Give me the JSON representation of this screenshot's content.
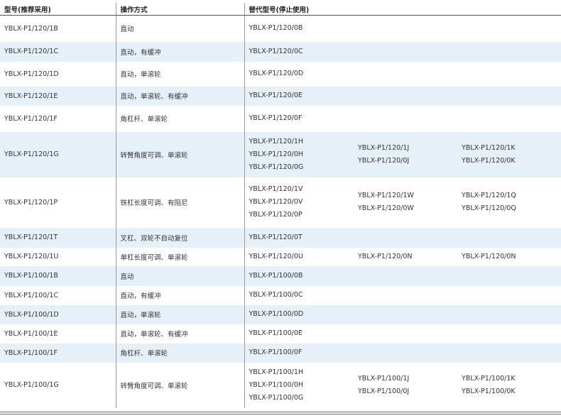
{
  "headers": [
    "型号(推荐采用)",
    "操作方式",
    "替代型号(停止使用)"
  ],
  "rows": [
    {
      "model": "YBLX-P1/120/1B",
      "op": "直动",
      "alt": [
        [
          "YBLX-P1/120/0B"
        ],
        [],
        []
      ]
    },
    {
      "model": "YBLX-P1/120/1C",
      "op": "直动，有缓冲",
      "alt": [
        [
          "YBLX-P1/120/0C"
        ],
        [],
        []
      ]
    },
    {
      "model": "YBLX-P1/120/1D",
      "op": "直动，单滚轮",
      "alt": [
        [
          "YBLX-P1/120/0D"
        ],
        [],
        []
      ]
    },
    {
      "model": "YBLX-P1/120/1E",
      "op": "直动，单滚轮、有缓冲",
      "alt": [
        [
          "YBLX-P1/120/0E"
        ],
        [],
        []
      ]
    },
    {
      "model": "YBLX-P1/120/1F",
      "op": "角杠杆、单滚轮",
      "alt": [
        [
          "YBLX-P1/120/0F"
        ],
        [],
        []
      ]
    },
    {
      "model": "YBLX-P1/120/1G",
      "op": "转臂角度可调、单滚轮",
      "alt": [
        [
          "YBLX-P1/120/1H",
          "YBLX-P1/120/0H",
          "YBLX-P1/120/0G"
        ],
        [
          "YBLX-P1/120/1J",
          "YBLX-P1/120/0J"
        ],
        [
          "YBLX-P1/120/1K",
          "YBLX-P1/120/0K"
        ]
      ]
    },
    {
      "model": "YBLX-P1/120/1P",
      "op": "铁杠长度可调、有阻尼",
      "alt": [
        [
          "YBLX-P1/120/1V",
          "YBLX-P1/120/0V",
          "YBLX-P1/120/0P"
        ],
        [
          "YBLX-P1/120/1W",
          "YBLX-P1/120/0W"
        ],
        [
          "YBLX-P1/120/1Q",
          "YBLX-P1/120/0Q"
        ]
      ]
    },
    {
      "model": "YBLX-P1/120/1T",
      "op": "叉杠、双轮不自动复位",
      "alt": [
        [
          "YBLX-P1/120/0T"
        ],
        [],
        []
      ]
    },
    {
      "model": "YBLX-P1/120/1U",
      "op": "单杠长度可调、单滚轮",
      "alt": [
        [
          "YBLX-P1/120/0U"
        ],
        [
          "YBLX-P1/120/0N"
        ],
        [
          "YBLX-P1/120/0N"
        ]
      ]
    },
    {
      "model": "YBLX-P1/100/1B",
      "op": "直动",
      "alt": [
        [
          "YBLX-P1/100/0B"
        ],
        [],
        []
      ]
    },
    {
      "model": "YBLX-P1/100/1C",
      "op": "直动，有缓冲",
      "alt": [
        [
          "YBLX-P1/100/0C"
        ],
        [],
        []
      ]
    },
    {
      "model": "YBLX-P1/100/1D",
      "op": "直动，单滚轮",
      "alt": [
        [
          "YBLX-P1/100/0D"
        ],
        [],
        []
      ]
    },
    {
      "model": "YBLX-P1/100/1E",
      "op": "直动，单滚轮、有缓冲",
      "alt": [
        [
          "YBLX-P1/100/0E"
        ],
        [],
        []
      ]
    },
    {
      "model": "YBLX-P1/100/1F",
      "op": "角杠杆、单滚轮",
      "alt": [
        [
          "YBLX-P1/100/0F"
        ],
        [],
        []
      ]
    },
    {
      "model": "YBLX-P1/100/1G",
      "op": "转臂角度可调、单滚轮",
      "alt": [
        [
          "YBLX-P1/100/1H",
          "YBLX-P1/100/0H",
          "YBLX-P1/100/0G"
        ],
        [
          "YBLX-P1/100/1J",
          "YBLX-P1/100/0J"
        ],
        [
          "YBLX-P1/100/1K",
          "YBLX-P1/100/0K"
        ]
      ]
    }
  ]
}
